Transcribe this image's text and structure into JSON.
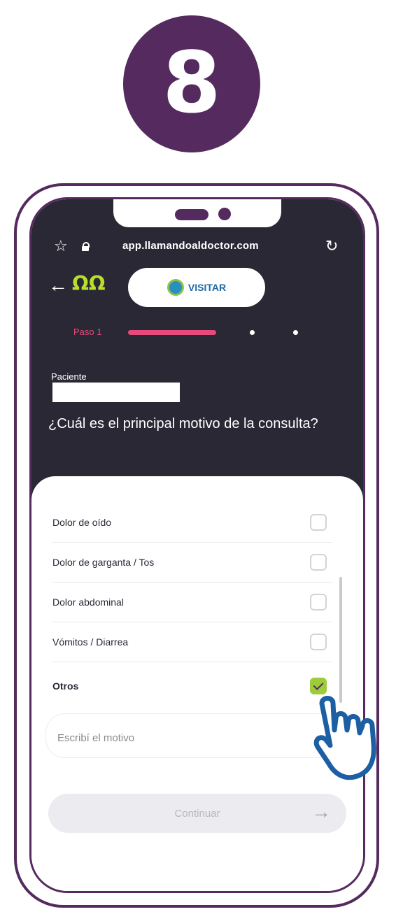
{
  "step_number": "8",
  "browser": {
    "url": "app.llamandoaldoctor.com"
  },
  "header": {
    "app_logo": "ΩΩ",
    "partner_name": "VISITAR"
  },
  "progress": {
    "step_label": "Paso 1"
  },
  "patient": {
    "label": "Paciente"
  },
  "question": "¿Cuál es el principal motivo de la consulta?",
  "options": [
    {
      "label": "Dolor de oído",
      "checked": false
    },
    {
      "label": "Dolor de garganta / Tos",
      "checked": false
    },
    {
      "label": "Dolor abdominal",
      "checked": false
    },
    {
      "label": "Vómitos / Diarrea",
      "checked": false
    },
    {
      "label": "Otros",
      "checked": true
    }
  ],
  "motive_input": {
    "placeholder": "Escribí el motivo"
  },
  "continue_button": {
    "label": "Continuar"
  },
  "colors": {
    "brand_purple": "#552a5e",
    "dark_bg": "#2a2835",
    "accent_pink": "#e54a7a",
    "accent_green": "#9ccb3b"
  },
  "icons": [
    "star-icon",
    "lock-icon",
    "reload-icon",
    "back-arrow-icon",
    "app-logo",
    "partner-logo-icon",
    "checkmark-icon",
    "arrow-right-icon",
    "hand-pointer-icon"
  ]
}
